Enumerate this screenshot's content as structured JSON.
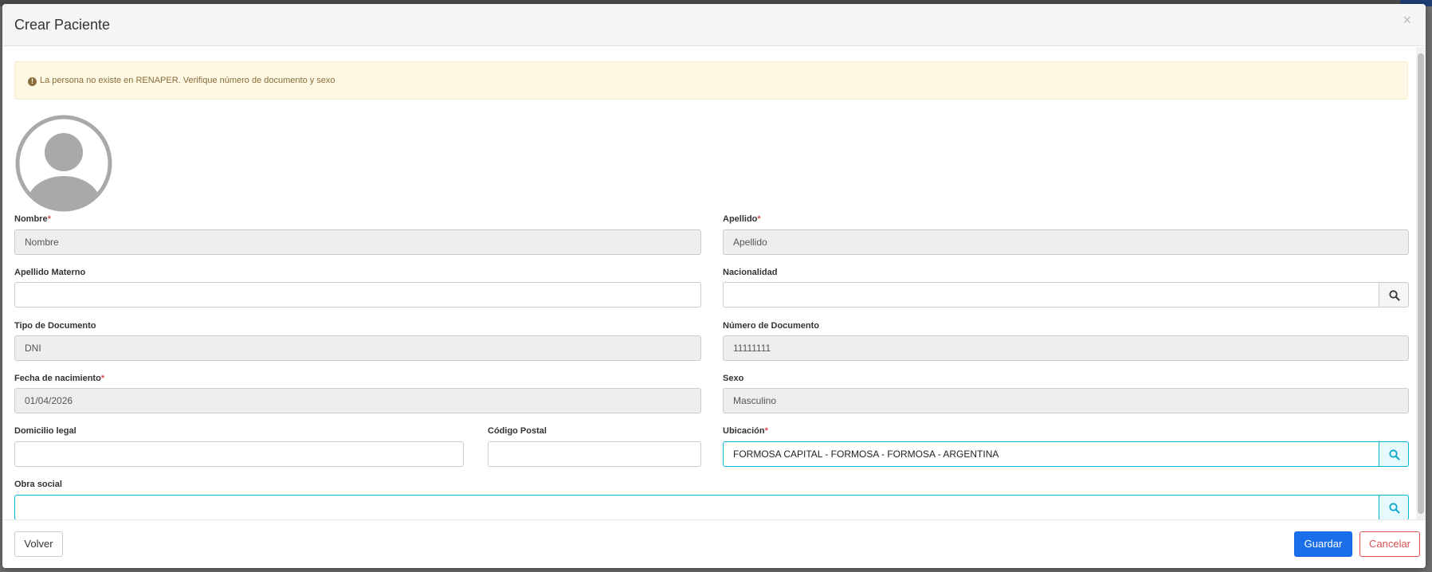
{
  "modal": {
    "title": "Crear Paciente",
    "close_glyph": "×"
  },
  "alert": {
    "icon": "exclamation-circle-icon",
    "message": "La persona no existe en RENAPER. Verifique número de documento y sexo"
  },
  "form": {
    "nombre": {
      "label": "Nombre",
      "placeholder": "Nombre",
      "value": "",
      "required": "*"
    },
    "apellido": {
      "label": "Apellido",
      "placeholder": "Apellido",
      "value": "",
      "required": "*"
    },
    "apellido_materno": {
      "label": "Apellido Materno",
      "value": ""
    },
    "nacionalidad": {
      "label": "Nacionalidad",
      "value": ""
    },
    "tipo_documento": {
      "label": "Tipo de Documento",
      "value": "DNI"
    },
    "numero_documento": {
      "label": "Número de Documento",
      "value": "11111111"
    },
    "fecha_nacimiento": {
      "label": "Fecha de nacimiento",
      "value": "01/04/2026",
      "required": "*"
    },
    "sexo": {
      "label": "Sexo",
      "value": "Masculino"
    },
    "domicilio_legal": {
      "label": "Domicilio legal",
      "value": ""
    },
    "codigo_postal": {
      "label": "Código Postal",
      "value": ""
    },
    "ubicacion": {
      "label": "Ubicación",
      "value": "FORMOSA CAPITAL - FORMOSA - FORMOSA - ARGENTINA",
      "required": "*"
    },
    "obra_social": {
      "label": "Obra social",
      "value": ""
    }
  },
  "footer": {
    "volver_label": "Volver",
    "guardar_label": "Guardar",
    "cancelar_label": "Cancelar"
  },
  "colors": {
    "primary": "#1a6fe8",
    "danger": "#d9534f",
    "focus": "#00b8d4",
    "warning_bg": "#fcf8e3"
  }
}
